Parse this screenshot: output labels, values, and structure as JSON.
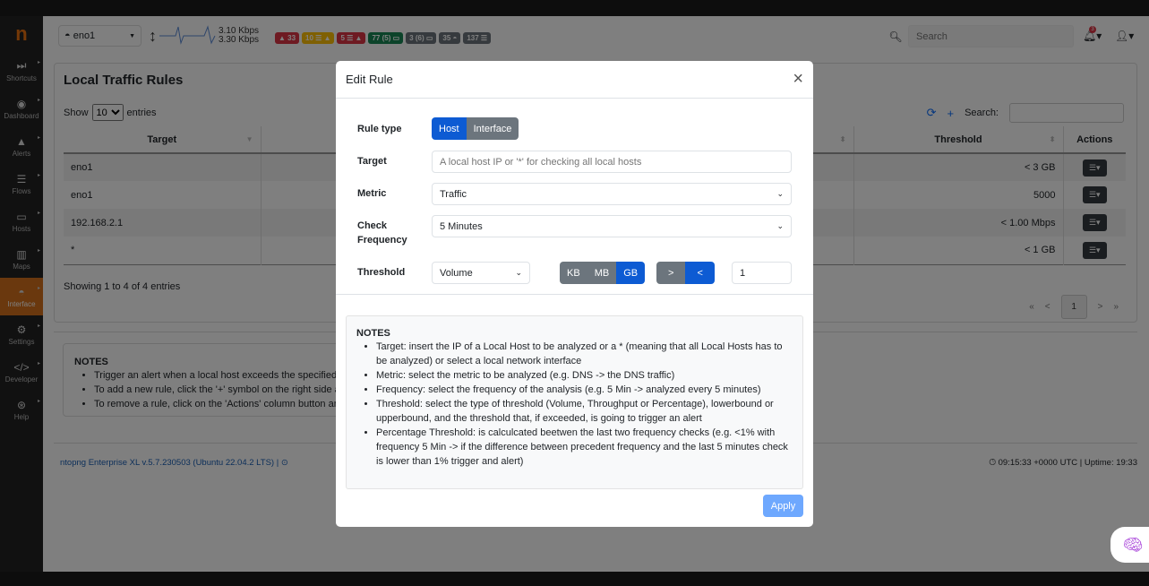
{
  "sidebar": {
    "items": [
      {
        "label": "Shortcuts",
        "icon": "fast-forward-icon"
      },
      {
        "label": "Dashboard",
        "icon": "gauge-icon"
      },
      {
        "label": "Alerts",
        "icon": "warning-icon"
      },
      {
        "label": "Flows",
        "icon": "bars-icon"
      },
      {
        "label": "Hosts",
        "icon": "laptop-icon"
      },
      {
        "label": "Maps",
        "icon": "map-icon"
      },
      {
        "label": "Interface",
        "icon": "ethernet-icon",
        "active": true
      },
      {
        "label": "Settings",
        "icon": "gear-icon"
      },
      {
        "label": "Developer",
        "icon": "code-icon"
      },
      {
        "label": "Help",
        "icon": "lifebuoy-icon"
      }
    ]
  },
  "navbar": {
    "interface": "eno1",
    "rate_up": "3.10 Kbps",
    "rate_down": "3.30 Kbps",
    "badges": [
      {
        "text": "▲ 33",
        "color": "#dc3545"
      },
      {
        "text": "10 ☰ ▲",
        "color": "#ffc107"
      },
      {
        "text": "5 ☰ ▲",
        "color": "#dc3545"
      },
      {
        "text": "77 (5) ▭",
        "color": "#198754"
      },
      {
        "text": "3 (6) ▭",
        "color": "#6c757d"
      },
      {
        "text": "35 ◓",
        "color": "#6c757d"
      },
      {
        "text": "137 ☰",
        "color": "#6c757d"
      }
    ],
    "search_placeholder": "Search",
    "notification_count": "3"
  },
  "page": {
    "title": "Local Traffic Rules",
    "show": "Show",
    "entries_value": "10",
    "entries": "entries",
    "search_label": "Search:",
    "columns": [
      "Target",
      "",
      "Threshold",
      "Actions"
    ],
    "rows": [
      {
        "target": "eno1",
        "threshold": "< 3 GB"
      },
      {
        "target": "eno1",
        "threshold": "5000"
      },
      {
        "target": "192.168.2.1",
        "threshold": "< 1.00 Mbps"
      },
      {
        "target": "*",
        "threshold": "< 1 GB"
      }
    ],
    "info": "Showing 1 to 4 of 4 entries",
    "pager": {
      "first": "«",
      "prev": "<",
      "current": "1",
      "next": ">",
      "last": "»"
    }
  },
  "notes": {
    "title": "NOTES",
    "items": [
      "Trigger an alert when a local host exceeds the specified tra",
      "To add a new rule, click the '+' symbol on the right side ab",
      "To remove a rule, click on the 'Actions' column button and"
    ]
  },
  "footer": {
    "version": "ntopng Enterprise XL v.5.7.230503 (Ubuntu 22.04.2 LTS) |",
    "time": "09:15:33 +0000 UTC | Uptime: 19:33"
  },
  "modal": {
    "title": "Edit Rule",
    "rule_type_label": "Rule type",
    "rule_types": [
      "Host",
      "Interface"
    ],
    "rule_type_selected": "Host",
    "target_label": "Target",
    "target_placeholder": "A local host IP or '*' for checking all local hosts",
    "metric_label": "Metric",
    "metric_value": "Traffic",
    "frequency_label": "Check Frequency",
    "frequency_value": "5 Minutes",
    "threshold_label": "Threshold",
    "threshold_type": "Volume",
    "units": [
      "KB",
      "MB",
      "GB"
    ],
    "unit_selected": "GB",
    "bounds": [
      ">",
      "<"
    ],
    "bound_selected": "<",
    "threshold_value": "1",
    "notes_title": "NOTES",
    "notes": [
      "Target: insert the IP of a Local Host to be analyzed or a * (meaning that all Local Hosts has to be analyzed) or select a local network interface",
      "Metric: select the metric to be analyzed (e.g. DNS -> the DNS traffic)",
      "Frequency: select the frequency of the analysis (e.g. 5 Min -> analyzed every 5 minutes)",
      "Threshold: select the type of threshold (Volume, Throughput or Percentage), lowerbound or upperbound, and the threshold that, if exceeded, is going to trigger an alert",
      "Percentage Threshold: is calculcated beetwen the last two frequency checks (e.g. <1% with frequency 5 Min -> if the difference between precedent frequency and the last 5 minutes check is lower than 1% trigger and alert)"
    ],
    "apply": "Apply"
  }
}
